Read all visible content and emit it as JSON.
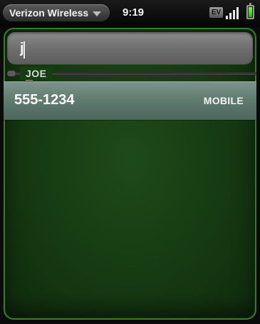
{
  "status_bar": {
    "carrier": "Verizon Wireless",
    "time": "9:19",
    "network_badge": "EV",
    "signal_bars": 4,
    "battery_level": 1.0,
    "battery_color": "#3cd400"
  },
  "search": {
    "value": "j"
  },
  "results": {
    "section_label": "JOE",
    "items": [
      {
        "number": "555-1234",
        "type": "MOBILE"
      }
    ]
  },
  "colors": {
    "card_green": "#173d13",
    "card_border": "#3b7a26",
    "row_highlight": "#6b8579"
  }
}
